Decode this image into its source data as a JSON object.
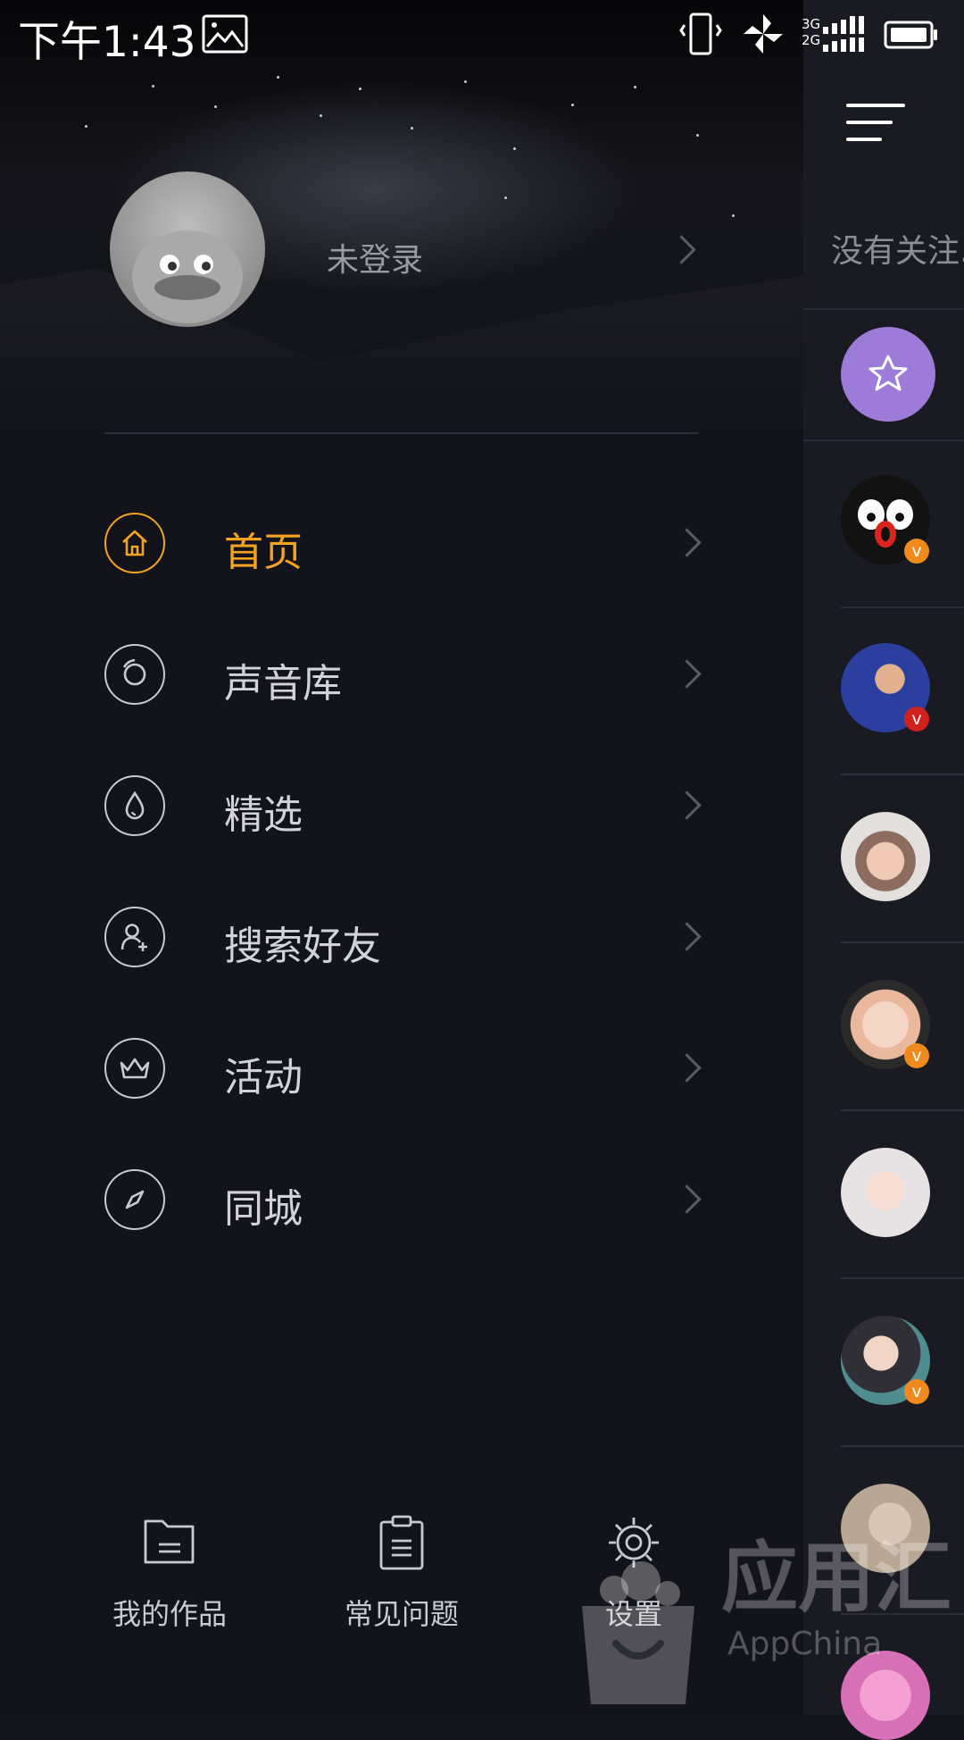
{
  "status_bar": {
    "time": "下午1:43",
    "icons": [
      "image-icon",
      "vibrate-icon",
      "pinwheel-icon",
      "signal-icon",
      "battery-icon"
    ],
    "network_labels": [
      "3G",
      "2G"
    ]
  },
  "profile": {
    "login_text": "未登录"
  },
  "menu": {
    "items": [
      {
        "label": "首页",
        "icon": "home-icon",
        "active": true
      },
      {
        "label": "声音库",
        "icon": "disc-icon"
      },
      {
        "label": "精选",
        "icon": "drop-icon"
      },
      {
        "label": "搜索好友",
        "icon": "add-user-icon"
      },
      {
        "label": "活动",
        "icon": "crown-icon"
      },
      {
        "label": "同城",
        "icon": "compass-icon"
      }
    ]
  },
  "bottom": {
    "works": "我的作品",
    "faq": "常见问题",
    "settings": "设置"
  },
  "panel": {
    "tip": "没有关注..."
  },
  "watermark": {
    "text": "应用汇",
    "sub": "AppChina"
  },
  "colors": {
    "accent": "#f4a323",
    "background": "#13131b",
    "star_button": "#9d7bd8",
    "badge": "#f08a1c"
  }
}
